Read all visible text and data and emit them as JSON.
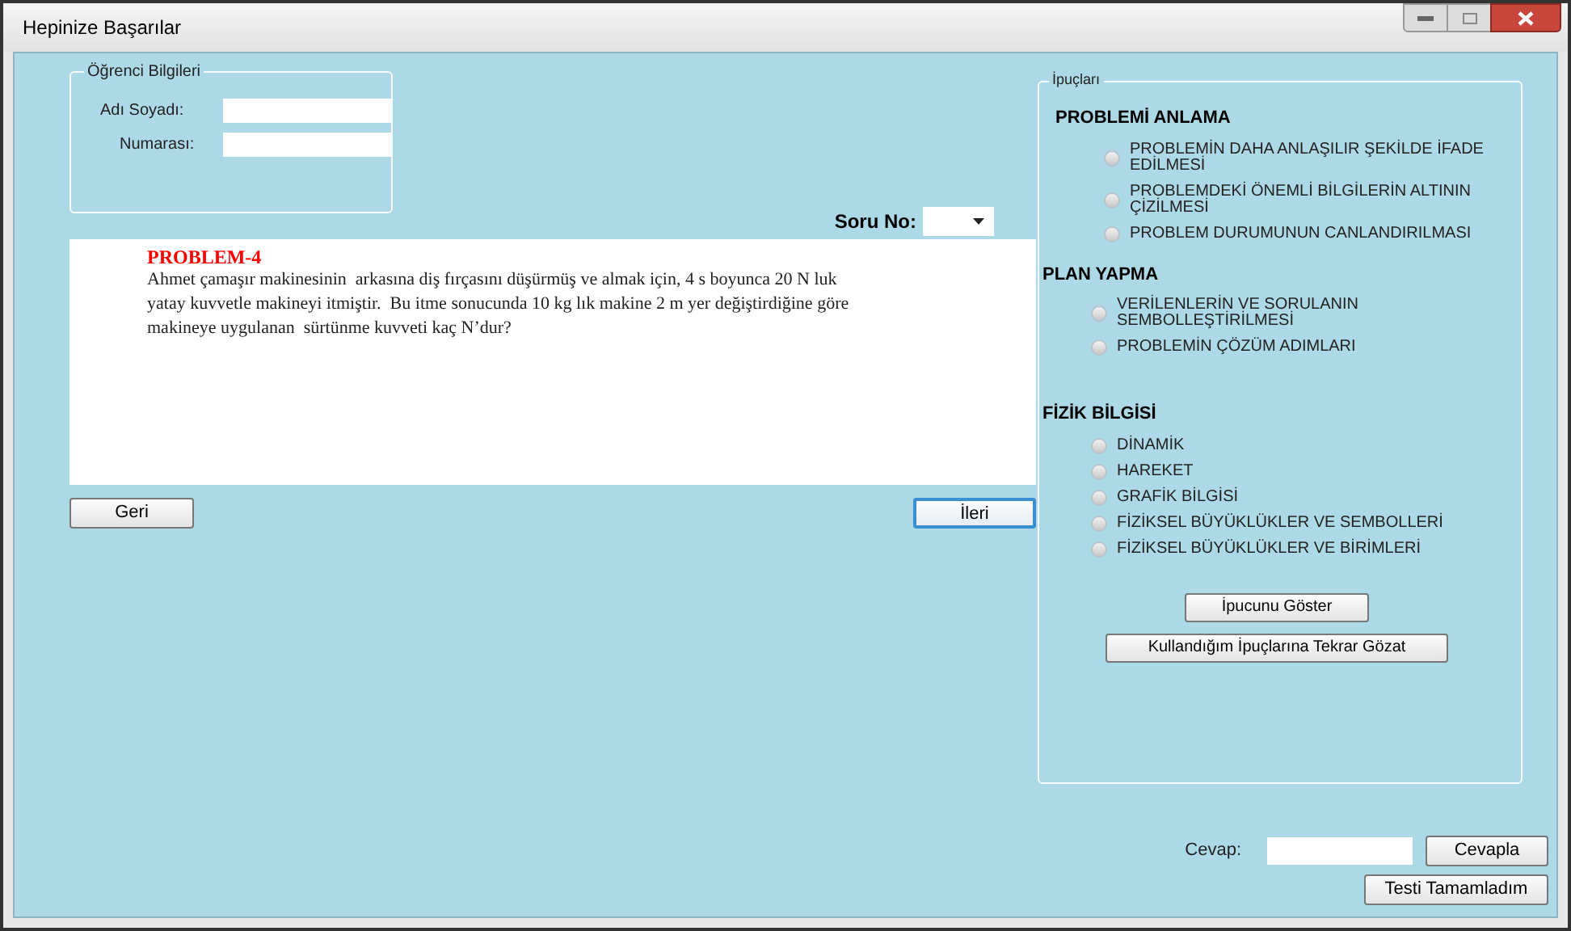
{
  "window": {
    "title": "Hepinize Başarılar"
  },
  "student_group": {
    "title": "Öğrenci Bilgileri",
    "fields": [
      {
        "label": "Adı Soyadı:"
      },
      {
        "label": "Numarası:"
      }
    ]
  },
  "question_selector": {
    "label": "Soru No:"
  },
  "problem": {
    "title": "PROBLEM-4",
    "text": "Ahmet çamaşır makinesinin  arkasına diş fırçasını düşürmüş ve almak için, 4 s boyunca 20 N luk yatay kuvvetle makineyi itmiştir.  Bu itme sonucunda 10 kg lık makine 2 m yer değiştirdiğine göre makineye uygulanan  sürtünme kuvveti kaç N’dur?"
  },
  "nav_buttons": [
    "Geri",
    "İleri"
  ],
  "hints": {
    "title": "İpuçları",
    "sections": [
      {
        "title": "PROBLEMİ ANLAMA",
        "options": [
          {
            "label": "PROBLEMİN DAHA ANLAŞILIR ŞEKİLDE İFADE EDİLMESİ",
            "selected": false
          },
          {
            "label": "PROBLEMDEKİ ÖNEMLİ BİLGİLERİN ALTININ ÇİZİLMESİ",
            "selected": false
          },
          {
            "label": "PROBLEM DURUMUNUN CANLANDIRILMASI",
            "selected": false
          }
        ]
      },
      {
        "title": "PLAN YAPMA",
        "options": [
          {
            "label": "VERİLENLERİN VE SORULANIN SEMBOLLEŞTİRİLMESİ",
            "selected": false
          },
          {
            "label": "PROBLEMİN ÇÖZÜM ADIMLARI",
            "selected": false
          }
        ]
      },
      {
        "title": "FİZİK BİLGİSİ",
        "options": [
          {
            "label": "DİNAMİK",
            "selected": false
          },
          {
            "label": "HAREKET",
            "selected": false
          },
          {
            "label": "GRAFİK BİLGİSİ",
            "selected": false
          },
          {
            "label": "FİZİKSEL BÜYÜKLÜKLER VE SEMBOLLERİ",
            "selected": false
          },
          {
            "label": "FİZİKSEL BÜYÜKLÜKLER VE BİRİMLERİ",
            "selected": false
          }
        ]
      }
    ],
    "buttons": [
      "İpucunu Göster",
      "Kullandığım İpuçlarına Tekrar Gözat"
    ]
  },
  "answer": {
    "label": "Cevap:",
    "button": "Cevapla"
  },
  "finish_button": "Testi Tamamladım"
}
